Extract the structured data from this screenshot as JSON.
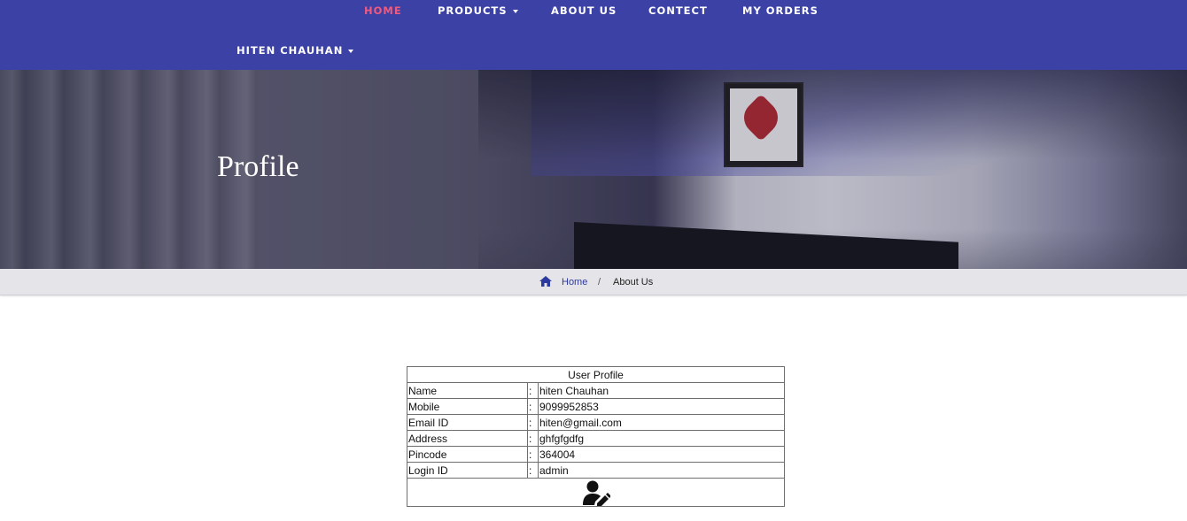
{
  "nav": {
    "home": "HOME",
    "products": "PRODUCTS",
    "about": "ABOUT US",
    "contact": "CONTECT",
    "orders": "MY ORDERS",
    "user": "HITEN CHAUHAN"
  },
  "hero": {
    "title": "Profile"
  },
  "breadcrumb": {
    "home": "Home",
    "separator": "/",
    "current": "About Us"
  },
  "profile": {
    "caption": "User Profile",
    "colon": ":",
    "rows": [
      {
        "label": "Name",
        "value": "hiten Chauhan"
      },
      {
        "label": "Mobile",
        "value": "9099952853"
      },
      {
        "label": "Email ID",
        "value": "hiten@gmail.com"
      },
      {
        "label": "Address",
        "value": "ghfgfgdfg"
      },
      {
        "label": "Pincode",
        "value": "364004"
      },
      {
        "label": "Login ID",
        "value": "admin"
      }
    ],
    "edit_icon": "user-edit-icon"
  },
  "colors": {
    "navbar": "#3c41a5",
    "nav_active": "#f05a7e",
    "breadcrumb_bg": "#e5e4e8",
    "breadcrumb_link": "#2c3aa0"
  }
}
